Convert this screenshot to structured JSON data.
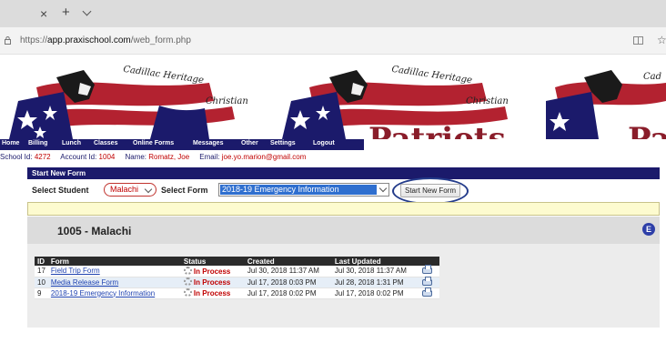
{
  "browser": {
    "tab_close": "×",
    "tab_new": "+",
    "url_prefix": "https://",
    "url_host": "app.praxischool.com",
    "url_path": "/web_form.php",
    "star": "☆"
  },
  "banner": {
    "school_line1": "Cadillac Heritage",
    "school_line2": "Christian",
    "mascot_text": "Patriots",
    "tile2_line1": "Cadillac Heritage",
    "tile2_line2": "Christian",
    "tile3_line1": "Cad",
    "colors": {
      "red": "#b32230",
      "navy": "#1b1a6b"
    }
  },
  "nav": {
    "items": [
      "Home",
      "Billing",
      "Lunch",
      "Classes",
      "Online Forms",
      "Messages",
      "Other",
      "Settings",
      "Logout"
    ]
  },
  "info": {
    "school_id_label": "School Id:",
    "school_id": "4272",
    "account_id_label": "Account Id:",
    "account_id": "1004",
    "name_label": "Name:",
    "name": "Romatz, Joe",
    "email_label": "Email:",
    "email": "joe.yo.marion@gmail.com"
  },
  "start_form": {
    "header": "Start New Form",
    "student_label": "Select Student",
    "student_value": "Malachi",
    "form_label": "Select Form",
    "form_value": "2018-19 Emergency Information",
    "button_label": "Start New Form"
  },
  "student_panel": {
    "title": "1005 - Malachi",
    "icon_letter": "E"
  },
  "table": {
    "headers": [
      "ID",
      "Form",
      "Status",
      "Created",
      "Last Updated",
      ""
    ],
    "rows": [
      {
        "id": "17",
        "form": "Field Trip Form",
        "status": "In Process",
        "created": "Jul 30, 2018 11:37 AM",
        "updated": "Jul 30, 2018 11:37 AM"
      },
      {
        "id": "10",
        "form": "Media Release Form",
        "status": "In Process",
        "created": "Jul 17, 2018 0:03 PM",
        "updated": "Jul 28, 2018 1:31 PM"
      },
      {
        "id": "9",
        "form": "2018-19 Emergency Information",
        "status": "In Process",
        "created": "Jul 17, 2018 0:02 PM",
        "updated": "Jul 17, 2018 0:02 PM"
      }
    ]
  }
}
